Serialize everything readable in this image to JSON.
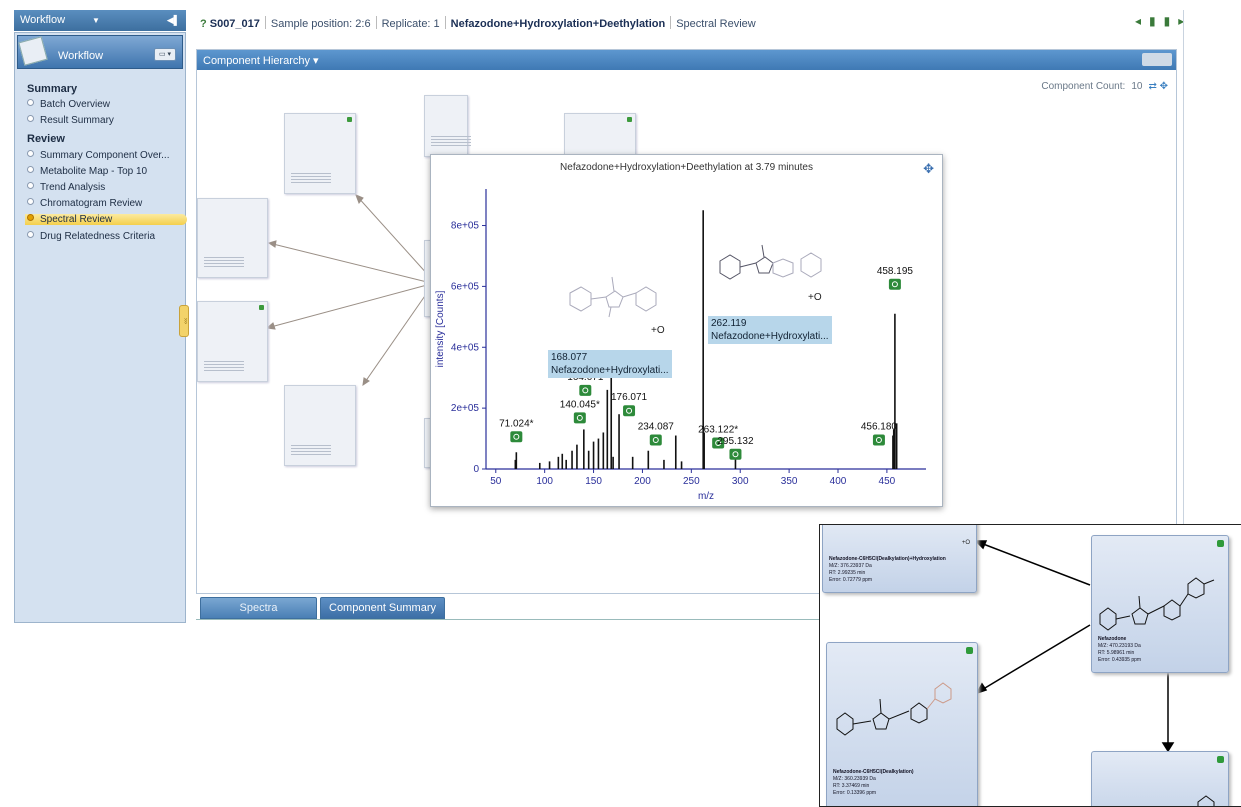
{
  "workflow_panel": {
    "top_label": "Workflow",
    "header_title": "Workflow",
    "summary_heading": "Summary",
    "summary_items": [
      "Batch Overview",
      "Result Summary"
    ],
    "review_heading": "Review",
    "review_items": [
      "Summary Component Over...",
      "Metabolite Map - Top 10",
      "Trend Analysis",
      "Chromatogram Review",
      "Spectral Review",
      "Drug Relatedness Criteria"
    ],
    "selected_item": "Spectral Review"
  },
  "breadcrumb": {
    "sample": "S007_017",
    "position": "Sample position: 2:6",
    "replicate": "Replicate: 1",
    "component": "Nefazodone+Hydroxylation+Deethylation",
    "view": "Spectral Review"
  },
  "hierarchy": {
    "menu_label": "Component Hierarchy",
    "count_label": "Component Count:",
    "count_value": "10"
  },
  "tabs": [
    "Spectra",
    "Component Summary"
  ],
  "spectrum": {
    "title": "Nefazodone+Hydroxylation+Deethylation at 3.79 minutes",
    "highlight1": {
      "mz": "168.077",
      "name": "Nefazodone+Hydroxylati..."
    },
    "highlight2": {
      "mz": "262.119",
      "name": "Nefazodone+Hydroxylati..."
    },
    "plus_o_1": "+O",
    "plus_o_2": "+O"
  },
  "inset": {
    "box1_lines": [
      "Nefazodone-C6H5Cl(Dealkylation)+Hydroxylation",
      "M/Z: 376.23937 Da",
      "RT: 2.99235 min",
      "Error: 0.72779 ppm"
    ],
    "box1_tag": "+O",
    "box2_lines": [
      "Nefazodone",
      "M/Z: 470.23193 Da",
      "RT: 5.98961 min",
      "Error: 0.43935 ppm"
    ],
    "box3_lines": [
      "Nefazodone-C6H5Cl(Dealkylation)",
      "M/Z: 360.23939 Da",
      "RT: 3.37469 min",
      "Error: 0.13396 ppm"
    ]
  },
  "chart_data": {
    "type": "bar",
    "title": "Nefazodone+Hydroxylation+Deethylation at 3.79 minutes",
    "xlabel": "m/z",
    "ylabel": "intensity [Counts]",
    "xlim": [
      40,
      490
    ],
    "ylim": [
      0,
      920000
    ],
    "xticks": [
      50,
      100,
      150,
      200,
      250,
      300,
      350,
      400,
      450
    ],
    "yticks": [
      0,
      200000,
      400000,
      600000,
      800000
    ],
    "ytick_labels": [
      "0",
      "2e+05",
      "4e+05",
      "6e+05",
      "8e+05"
    ],
    "peaks": [
      {
        "mz": 70,
        "i": 30000
      },
      {
        "mz": 71.024,
        "i": 55000
      },
      {
        "mz": 95,
        "i": 20000
      },
      {
        "mz": 105,
        "i": 25000
      },
      {
        "mz": 114,
        "i": 40000
      },
      {
        "mz": 118,
        "i": 50000
      },
      {
        "mz": 122,
        "i": 30000
      },
      {
        "mz": 128,
        "i": 60000
      },
      {
        "mz": 133,
        "i": 80000
      },
      {
        "mz": 140.045,
        "i": 130000
      },
      {
        "mz": 145,
        "i": 60000
      },
      {
        "mz": 150,
        "i": 90000
      },
      {
        "mz": 155,
        "i": 100000
      },
      {
        "mz": 160,
        "i": 120000
      },
      {
        "mz": 164.071,
        "i": 260000
      },
      {
        "mz": 168.077,
        "i": 320000
      },
      {
        "mz": 170,
        "i": 40000
      },
      {
        "mz": 176.071,
        "i": 180000
      },
      {
        "mz": 190,
        "i": 40000
      },
      {
        "mz": 206,
        "i": 60000
      },
      {
        "mz": 222,
        "i": 30000
      },
      {
        "mz": 234.087,
        "i": 110000
      },
      {
        "mz": 240,
        "i": 25000
      },
      {
        "mz": 262.119,
        "i": 850000
      },
      {
        "mz": 263.122,
        "i": 120000
      },
      {
        "mz": 295.132,
        "i": 50000
      },
      {
        "mz": 456.18,
        "i": 110000
      },
      {
        "mz": 457,
        "i": 130000
      },
      {
        "mz": 458.195,
        "i": 510000
      },
      {
        "mz": 460,
        "i": 150000
      }
    ],
    "labels": [
      {
        "text": "71.024*",
        "mz": 71.024,
        "i": 55000,
        "dx": 0,
        "dy": -26
      },
      {
        "text": "140.045*",
        "mz": 140.045,
        "i": 130000,
        "dx": -4,
        "dy": -22
      },
      {
        "text": "164.071",
        "mz": 164.071,
        "i": 260000,
        "dx": -22,
        "dy": -10
      },
      {
        "text": "176.071",
        "mz": 176.071,
        "i": 180000,
        "dx": 10,
        "dy": -14
      },
      {
        "text": "234.087",
        "mz": 234.087,
        "i": 110000,
        "dx": -20,
        "dy": -6
      },
      {
        "text": "263.122*",
        "mz": 263.122,
        "i": 120000,
        "dx": 14,
        "dy": 0
      },
      {
        "text": "295.132",
        "mz": 295.132,
        "i": 50000,
        "dx": 0,
        "dy": -10
      },
      {
        "text": "458.195",
        "mz": 458.195,
        "i": 510000,
        "dx": 0,
        "dy": -40
      },
      {
        "text": "456.180",
        "mz": 456.18,
        "i": 110000,
        "dx": -14,
        "dy": -6
      }
    ]
  }
}
